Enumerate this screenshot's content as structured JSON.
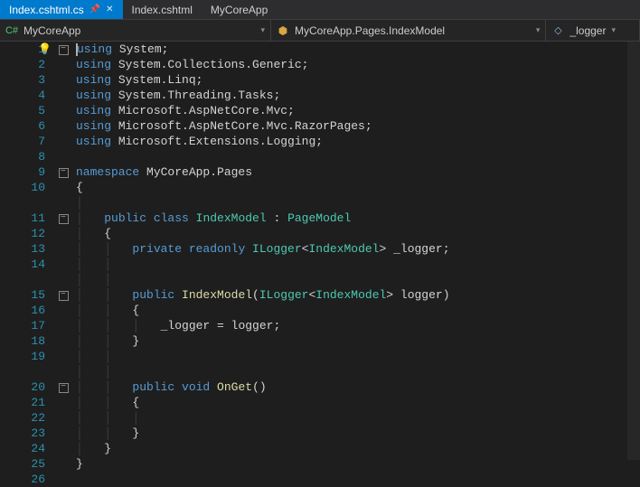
{
  "tabs": {
    "items": [
      {
        "label": "Index.cshtml.cs",
        "active": true,
        "pinned": true,
        "closable": true
      },
      {
        "label": "Index.cshtml",
        "active": false
      },
      {
        "label": "MyCoreApp",
        "active": false
      }
    ]
  },
  "navbar": {
    "project": "MyCoreApp",
    "class": "MyCoreApp.Pages.IndexModel",
    "member": "_logger"
  },
  "code": {
    "lines": [
      {
        "n": 1,
        "fold": "minus",
        "tokens": [
          [
            "kw",
            "using "
          ],
          [
            "ns",
            "System"
          ],
          [
            "punc",
            ";"
          ]
        ],
        "bulb": true,
        "caret": true
      },
      {
        "n": 2,
        "tokens": [
          [
            "kw",
            "using "
          ],
          [
            "ns",
            "System.Collections.Generic"
          ],
          [
            "punc",
            ";"
          ]
        ]
      },
      {
        "n": 3,
        "tokens": [
          [
            "kw",
            "using "
          ],
          [
            "ns",
            "System.Linq"
          ],
          [
            "punc",
            ";"
          ]
        ]
      },
      {
        "n": 4,
        "tokens": [
          [
            "kw",
            "using "
          ],
          [
            "ns",
            "System.Threading.Tasks"
          ],
          [
            "punc",
            ";"
          ]
        ]
      },
      {
        "n": 5,
        "tokens": [
          [
            "kw",
            "using "
          ],
          [
            "ns",
            "Microsoft.AspNetCore.Mvc"
          ],
          [
            "punc",
            ";"
          ]
        ]
      },
      {
        "n": 6,
        "tokens": [
          [
            "kw",
            "using "
          ],
          [
            "ns",
            "Microsoft.AspNetCore.Mvc.RazorPages"
          ],
          [
            "punc",
            ";"
          ]
        ]
      },
      {
        "n": 7,
        "tokens": [
          [
            "kw",
            "using "
          ],
          [
            "ns",
            "Microsoft.Extensions.Logging"
          ],
          [
            "punc",
            ";"
          ]
        ]
      },
      {
        "n": 8,
        "tokens": []
      },
      {
        "n": 9,
        "fold": "minus",
        "tokens": [
          [
            "kw",
            "namespace "
          ],
          [
            "ns",
            "MyCoreApp.Pages"
          ]
        ]
      },
      {
        "n": 10,
        "tokens": [
          [
            "punc",
            "{"
          ]
        ]
      },
      {
        "n": "",
        "tokens": [
          [
            "guide",
            "│"
          ]
        ]
      },
      {
        "n": 11,
        "fold": "minus",
        "tokens": [
          [
            "guide",
            "│   "
          ],
          [
            "kw",
            "public class "
          ],
          [
            "type",
            "IndexModel"
          ],
          [
            "punc",
            " : "
          ],
          [
            "type",
            "PageModel"
          ]
        ]
      },
      {
        "n": 12,
        "tokens": [
          [
            "guide",
            "│   "
          ],
          [
            "punc",
            "{"
          ]
        ]
      },
      {
        "n": 13,
        "tokens": [
          [
            "guide",
            "│   │   "
          ],
          [
            "kw",
            "private readonly "
          ],
          [
            "type",
            "ILogger"
          ],
          [
            "punc",
            "<"
          ],
          [
            "type",
            "IndexModel"
          ],
          [
            "punc",
            "> "
          ],
          [
            "field",
            "_logger"
          ],
          [
            "punc",
            ";"
          ]
        ]
      },
      {
        "n": 14,
        "tokens": [
          [
            "guide",
            "│   │"
          ]
        ]
      },
      {
        "n": "",
        "tokens": [
          [
            "guide",
            "│   │"
          ]
        ]
      },
      {
        "n": 15,
        "fold": "minus",
        "tokens": [
          [
            "guide",
            "│   │   "
          ],
          [
            "kw",
            "public "
          ],
          [
            "method",
            "IndexModel"
          ],
          [
            "punc",
            "("
          ],
          [
            "type",
            "ILogger"
          ],
          [
            "punc",
            "<"
          ],
          [
            "type",
            "IndexModel"
          ],
          [
            "punc",
            "> "
          ],
          [
            "ns",
            "logger"
          ],
          [
            "punc",
            ")"
          ]
        ]
      },
      {
        "n": 16,
        "tokens": [
          [
            "guide",
            "│   │   "
          ],
          [
            "punc",
            "{"
          ]
        ]
      },
      {
        "n": 17,
        "tokens": [
          [
            "guide",
            "│   │   │   "
          ],
          [
            "field",
            "_logger"
          ],
          [
            "punc",
            " = logger;"
          ]
        ]
      },
      {
        "n": 18,
        "tokens": [
          [
            "guide",
            "│   │   "
          ],
          [
            "punc",
            "}"
          ]
        ]
      },
      {
        "n": 19,
        "tokens": [
          [
            "guide",
            "│   │"
          ]
        ]
      },
      {
        "n": "",
        "tokens": [
          [
            "guide",
            "│   │"
          ]
        ]
      },
      {
        "n": 20,
        "fold": "minus",
        "tokens": [
          [
            "guide",
            "│   │   "
          ],
          [
            "kw",
            "public void "
          ],
          [
            "method",
            "OnGet"
          ],
          [
            "punc",
            "()"
          ]
        ]
      },
      {
        "n": 21,
        "tokens": [
          [
            "guide",
            "│   │   "
          ],
          [
            "punc",
            "{"
          ]
        ]
      },
      {
        "n": 22,
        "tokens": [
          [
            "guide",
            "│   │   │"
          ]
        ]
      },
      {
        "n": 23,
        "tokens": [
          [
            "guide",
            "│   │   "
          ],
          [
            "punc",
            "}"
          ]
        ]
      },
      {
        "n": 24,
        "tokens": [
          [
            "guide",
            "│   "
          ],
          [
            "punc",
            "}"
          ]
        ]
      },
      {
        "n": 25,
        "tokens": [
          [
            "punc",
            "}"
          ]
        ]
      },
      {
        "n": 26,
        "tokens": []
      }
    ]
  }
}
